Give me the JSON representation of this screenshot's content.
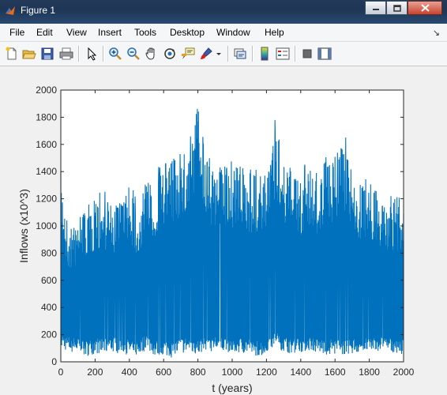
{
  "window": {
    "title": "Figure 1"
  },
  "menu": [
    "File",
    "Edit",
    "View",
    "Insert",
    "Tools",
    "Desktop",
    "Window",
    "Help"
  ],
  "toolbar": {
    "icons": [
      "new-figure-icon",
      "open-file-icon",
      "save-icon",
      "print-icon",
      "edit-plot-arrow-icon",
      "zoom-in-icon",
      "zoom-out-icon",
      "pan-hand-icon",
      "rotate-3d-icon",
      "data-cursor-icon",
      "brush-icon",
      "brush-dropdown-icon",
      "link-plot-icon",
      "insert-colorbar-icon",
      "insert-legend-icon",
      "hide-plot-tools-icon",
      "show-plot-tools-icon"
    ]
  },
  "colors": {
    "line": "#0072bd",
    "titlebar": "#1e3556",
    "background": "#f0f0f0"
  },
  "chart_data": {
    "type": "line",
    "title": "",
    "xlabel": "t (years)",
    "ylabel": "Inflows (x10^3)",
    "xlim": [
      0,
      2000
    ],
    "ylim": [
      0,
      2000
    ],
    "xticks": [
      0,
      200,
      400,
      600,
      800,
      1000,
      1200,
      1400,
      1600,
      1800,
      2000
    ],
    "yticks": [
      0,
      200,
      400,
      600,
      800,
      1000,
      1200,
      1400,
      1600,
      1800,
      2000
    ],
    "grid": false,
    "series": [
      {
        "x": [
          0,
          50,
          100,
          150,
          200,
          250,
          300,
          350,
          400,
          450,
          500,
          550,
          600,
          650,
          700,
          750,
          800,
          850,
          900,
          950,
          1000,
          1050,
          1100,
          1150,
          1200,
          1250,
          1300,
          1350,
          1400,
          1450,
          1500,
          1550,
          1600,
          1650,
          1700,
          1750,
          1800,
          1850,
          1900,
          1950,
          2000
        ],
        "upper": [
          1400,
          950,
          1050,
          1150,
          1180,
          1200,
          1150,
          1180,
          1250,
          1150,
          1300,
          1350,
          1400,
          1500,
          1500,
          1600,
          1950,
          1500,
          1350,
          1450,
          1400,
          1450,
          1350,
          1400,
          1300,
          1750,
          1450,
          1350,
          1350,
          1450,
          1350,
          1500,
          1450,
          1650,
          1350,
          1300,
          1300,
          1250,
          1150,
          1200,
          1100
        ],
        "lower": [
          100,
          70,
          60,
          40,
          60,
          60,
          70,
          60,
          50,
          40,
          90,
          40,
          50,
          30,
          60,
          70,
          50,
          70,
          80,
          70,
          70,
          60,
          60,
          40,
          50,
          130,
          70,
          60,
          70,
          80,
          60,
          50,
          60,
          50,
          60,
          60,
          70,
          80,
          60,
          70,
          50
        ]
      }
    ]
  }
}
